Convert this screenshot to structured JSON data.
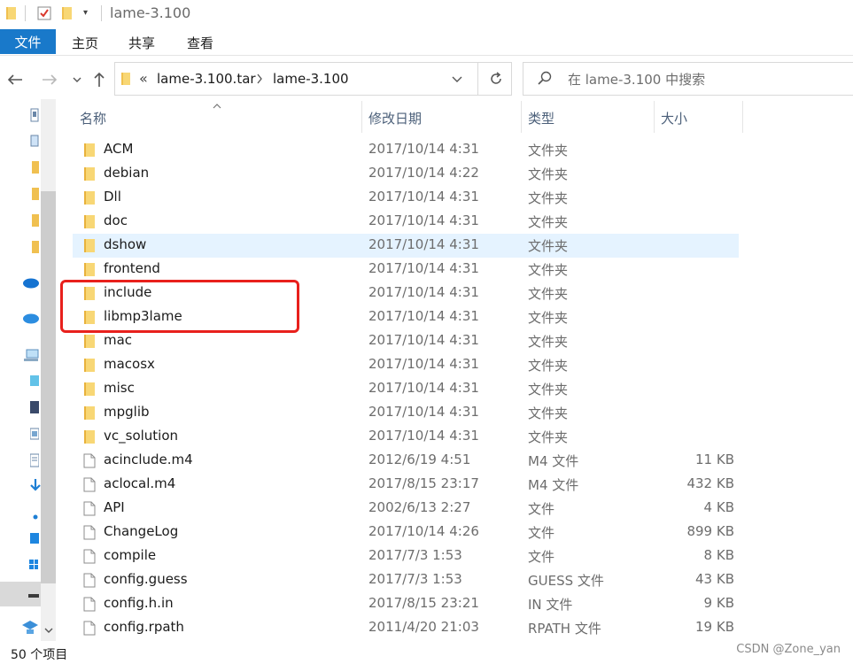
{
  "window": {
    "title": "lame-3.100"
  },
  "ribbon": {
    "tabs": [
      "文件",
      "主页",
      "共享",
      "查看"
    ]
  },
  "address": {
    "overflow": "«",
    "crumbs": [
      "lame-3.100.tar",
      "lame-3.100"
    ]
  },
  "search": {
    "placeholder": "在 lame-3.100 中搜索"
  },
  "columns": {
    "name": "名称",
    "date": "修改日期",
    "type": "类型",
    "size": "大小"
  },
  "files": [
    {
      "name": "ACM",
      "date": "2017/10/14 4:31",
      "type": "文件夹",
      "size": "",
      "kind": "folder"
    },
    {
      "name": "debian",
      "date": "2017/10/14 4:22",
      "type": "文件夹",
      "size": "",
      "kind": "folder"
    },
    {
      "name": "Dll",
      "date": "2017/10/14 4:31",
      "type": "文件夹",
      "size": "",
      "kind": "folder"
    },
    {
      "name": "doc",
      "date": "2017/10/14 4:31",
      "type": "文件夹",
      "size": "",
      "kind": "folder"
    },
    {
      "name": "dshow",
      "date": "2017/10/14 4:31",
      "type": "文件夹",
      "size": "",
      "kind": "folder"
    },
    {
      "name": "frontend",
      "date": "2017/10/14 4:31",
      "type": "文件夹",
      "size": "",
      "kind": "folder"
    },
    {
      "name": "include",
      "date": "2017/10/14 4:31",
      "type": "文件夹",
      "size": "",
      "kind": "folder"
    },
    {
      "name": "libmp3lame",
      "date": "2017/10/14 4:31",
      "type": "文件夹",
      "size": "",
      "kind": "folder"
    },
    {
      "name": "mac",
      "date": "2017/10/14 4:31",
      "type": "文件夹",
      "size": "",
      "kind": "folder"
    },
    {
      "name": "macosx",
      "date": "2017/10/14 4:31",
      "type": "文件夹",
      "size": "",
      "kind": "folder"
    },
    {
      "name": "misc",
      "date": "2017/10/14 4:31",
      "type": "文件夹",
      "size": "",
      "kind": "folder"
    },
    {
      "name": "mpglib",
      "date": "2017/10/14 4:31",
      "type": "文件夹",
      "size": "",
      "kind": "folder"
    },
    {
      "name": "vc_solution",
      "date": "2017/10/14 4:31",
      "type": "文件夹",
      "size": "",
      "kind": "folder"
    },
    {
      "name": "acinclude.m4",
      "date": "2012/6/19 4:51",
      "type": "M4 文件",
      "size": "11 KB",
      "kind": "file"
    },
    {
      "name": "aclocal.m4",
      "date": "2017/8/15 23:17",
      "type": "M4 文件",
      "size": "432 KB",
      "kind": "file"
    },
    {
      "name": "API",
      "date": "2002/6/13 2:27",
      "type": "文件",
      "size": "4 KB",
      "kind": "file"
    },
    {
      "name": "ChangeLog",
      "date": "2017/10/14 4:26",
      "type": "文件",
      "size": "899 KB",
      "kind": "file"
    },
    {
      "name": "compile",
      "date": "2017/7/3 1:53",
      "type": "文件",
      "size": "8 KB",
      "kind": "file"
    },
    {
      "name": "config.guess",
      "date": "2017/7/3 1:53",
      "type": "GUESS 文件",
      "size": "43 KB",
      "kind": "file"
    },
    {
      "name": "config.h.in",
      "date": "2017/8/15 23:21",
      "type": "IN 文件",
      "size": "9 KB",
      "kind": "file"
    },
    {
      "name": "config.rpath",
      "date": "2011/4/20 21:03",
      "type": "RPATH 文件",
      "size": "19 KB",
      "kind": "file"
    }
  ],
  "hovered_row": "dshow",
  "highlighted_rows": [
    "include",
    "libmp3lame"
  ],
  "highlight_color": "#e8201c",
  "accent_color": "#1979ca",
  "status": {
    "item_count": "50 个项目"
  },
  "watermark": "CSDN @Zone_yan",
  "icons": {
    "folder": "folder-icon",
    "file": "file-icon"
  }
}
